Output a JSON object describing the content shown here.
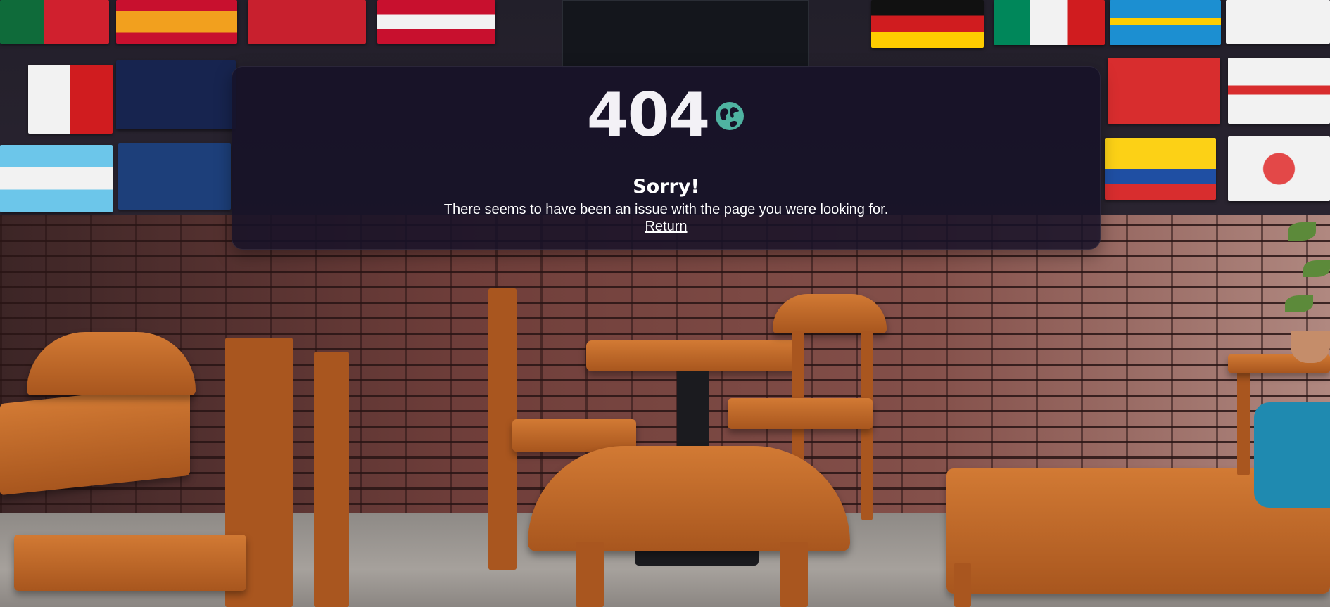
{
  "error": {
    "code": "404",
    "icon": "globe-icon",
    "title": "Sorry!",
    "message": "There seems to have been an issue with the page you were looking for.",
    "link_label": "Return"
  },
  "colors": {
    "card_background": "#161228",
    "text": "#ffffff",
    "globe": "#4fb3a1"
  }
}
